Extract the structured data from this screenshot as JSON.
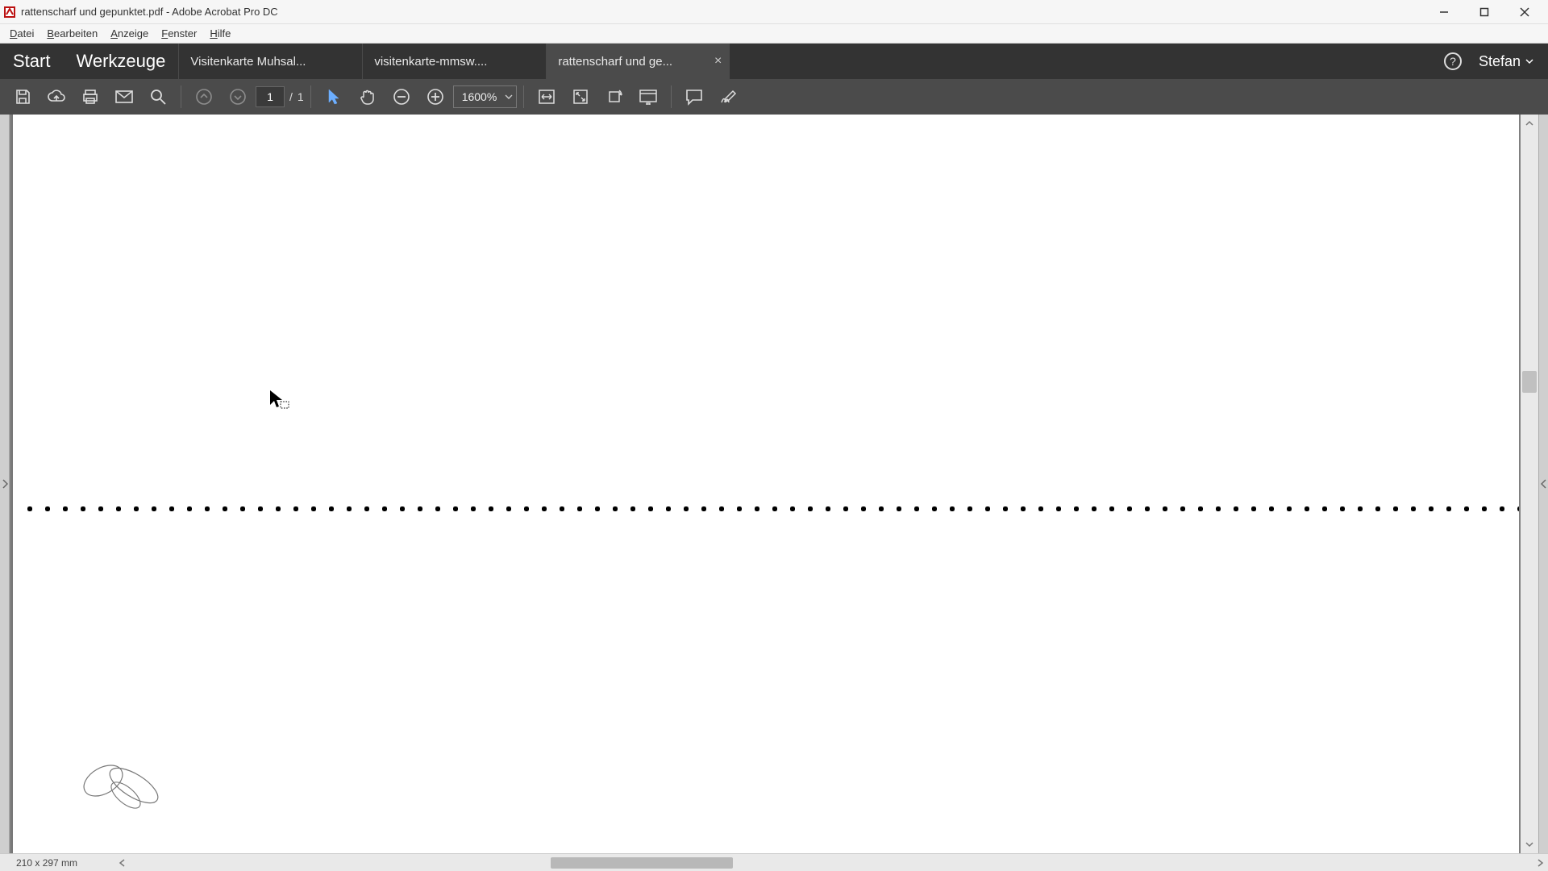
{
  "window": {
    "title": "rattenscharf und gepunktet.pdf - Adobe Acrobat Pro DC"
  },
  "menubar": {
    "items": [
      "Datei",
      "Bearbeiten",
      "Anzeige",
      "Fenster",
      "Hilfe"
    ]
  },
  "topnav": {
    "start": "Start",
    "tools": "Werkzeuge",
    "tabs": [
      {
        "label": "Visitenkarte Muhsal...",
        "active": false
      },
      {
        "label": "visitenkarte-mmsw....",
        "active": false
      },
      {
        "label": "rattenscharf und ge...",
        "active": true
      }
    ],
    "user": "Stefan"
  },
  "toolbar": {
    "page_current": "1",
    "page_sep": "/",
    "page_total": "1",
    "zoom": "1600%",
    "icons": {
      "save": "save-icon",
      "cloud": "cloud-upload-icon",
      "print": "print-icon",
      "mail": "mail-icon",
      "search": "search-icon",
      "page_up": "page-up-icon",
      "page_down": "page-down-icon",
      "select": "selection-tool-icon",
      "hand": "hand-tool-icon",
      "zoom_out": "zoom-out-icon",
      "zoom_in": "zoom-in-icon",
      "fit_width": "fit-width-icon",
      "fit_page": "fit-page-icon",
      "rotate": "rotate-view-icon",
      "read_mode": "read-mode-icon",
      "comment": "comment-icon",
      "sign": "sign-icon"
    }
  },
  "status": {
    "dimensions": "210 x 297 mm"
  },
  "scroll": {
    "v_thumb_top_pct": 34,
    "v_thumb_height_pct": 3,
    "h_thumb_left_pct": 30,
    "h_thumb_width_pct": 13
  }
}
